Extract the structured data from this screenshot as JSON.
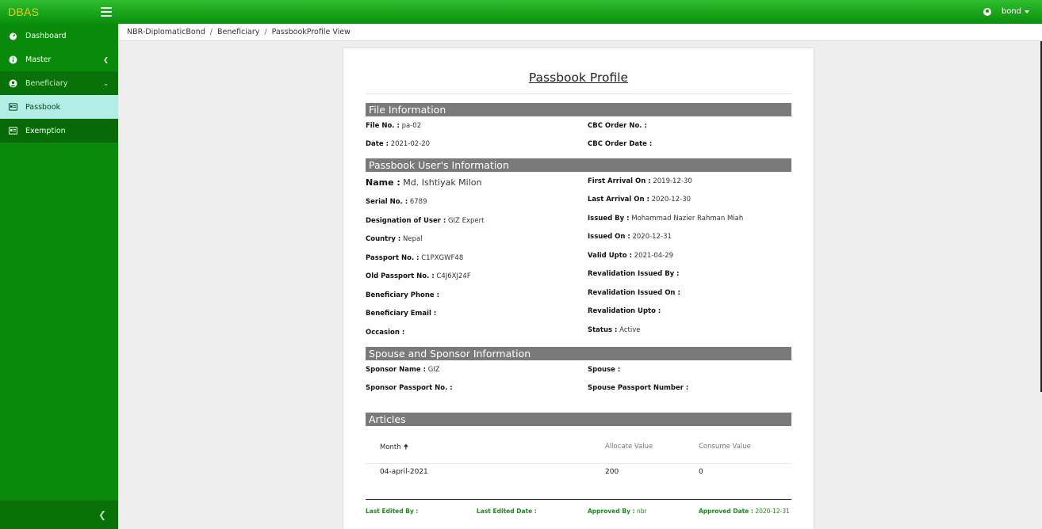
{
  "app": {
    "brand": "DBAS"
  },
  "user": {
    "name": "bond"
  },
  "sidebar": {
    "items": [
      {
        "label": "Dashboard"
      },
      {
        "label": "Master"
      },
      {
        "label": "Beneficiary"
      },
      {
        "label": "Passbook"
      },
      {
        "label": "Exemption"
      }
    ]
  },
  "breadcrumb": [
    "NBR-DiplomaticBond",
    "Beneficiary",
    "PassbookProfile View"
  ],
  "profile": {
    "title": "Passbook Profile",
    "file_section": "File Information",
    "file_no_label": "File No. :",
    "file_no": "pa-02",
    "date_label": "Date :",
    "date": "2021-02-20",
    "cbc_order_no_label": "CBC Order No. :",
    "cbc_order_no": "",
    "cbc_order_date_label": "CBC Order Date :",
    "cbc_order_date": "",
    "user_section": "Passbook User's Information",
    "name_label": "Name :",
    "name": "Md. Ishtiyak Milon",
    "serial_label": "Serial No. :",
    "serial": "6789",
    "designation_label": "Designation of User :",
    "designation": "GIZ Expert",
    "country_label": "Country :",
    "country": "Nepal",
    "passport_label": "Passport No. :",
    "passport": "C1PXGWF48",
    "old_passport_label": "Old Passport No. :",
    "old_passport": "C4J6XJ24F",
    "phone_label": "Beneficiary Phone :",
    "phone": "",
    "email_label": "Beneficiary Email :",
    "email": "",
    "occasion_label": "Occasion :",
    "occasion": "",
    "first_arrival_label": "First Arrival On :",
    "first_arrival": "2019-12-30",
    "last_arrival_label": "Last Arrival On :",
    "last_arrival": "2020-12-30",
    "issued_by_label": "Issued By :",
    "issued_by": "Mohammad Nazier Rahman Miah",
    "issued_on_label": "Issued On :",
    "issued_on": "2020-12-31",
    "valid_upto_label": "Valid Upto :",
    "valid_upto": "2021-04-29",
    "reval_issued_by_label": "Revalidation Issued By :",
    "reval_issued_by": "",
    "reval_issued_on_label": "Revalidation Issued On :",
    "reval_issued_on": "",
    "reval_upto_label": "Revalidation Upto :",
    "reval_upto": "",
    "status_label": "Status :",
    "status": "Active",
    "sponsor_section": "Spouse and Sponsor Information",
    "sponsor_name_label": "Sponsor Name :",
    "sponsor_name": "GIZ",
    "sponsor_passport_label": "Sponsor Passport No. :",
    "sponsor_passport": "",
    "spouse_label": "Spouse :",
    "spouse": "",
    "spouse_passport_label": "Spouse Passport Number :",
    "spouse_passport": "",
    "articles_section": "Articles",
    "articles": {
      "columns": [
        "Month",
        "Allocate Value",
        "Consume Value"
      ],
      "rows": [
        {
          "month": "04-april-2021",
          "allocate": "200",
          "consume": "0"
        }
      ]
    },
    "footer": {
      "last_edited_by_label": "Last Edited By :",
      "last_edited_by": "",
      "last_edited_date_label": "Last Edited Date :",
      "last_edited_date": "",
      "approved_by_label": "Approved By :",
      "approved_by": "nbr",
      "approved_date_label": "Approved Date :",
      "approved_date": "2020-12-31"
    }
  }
}
